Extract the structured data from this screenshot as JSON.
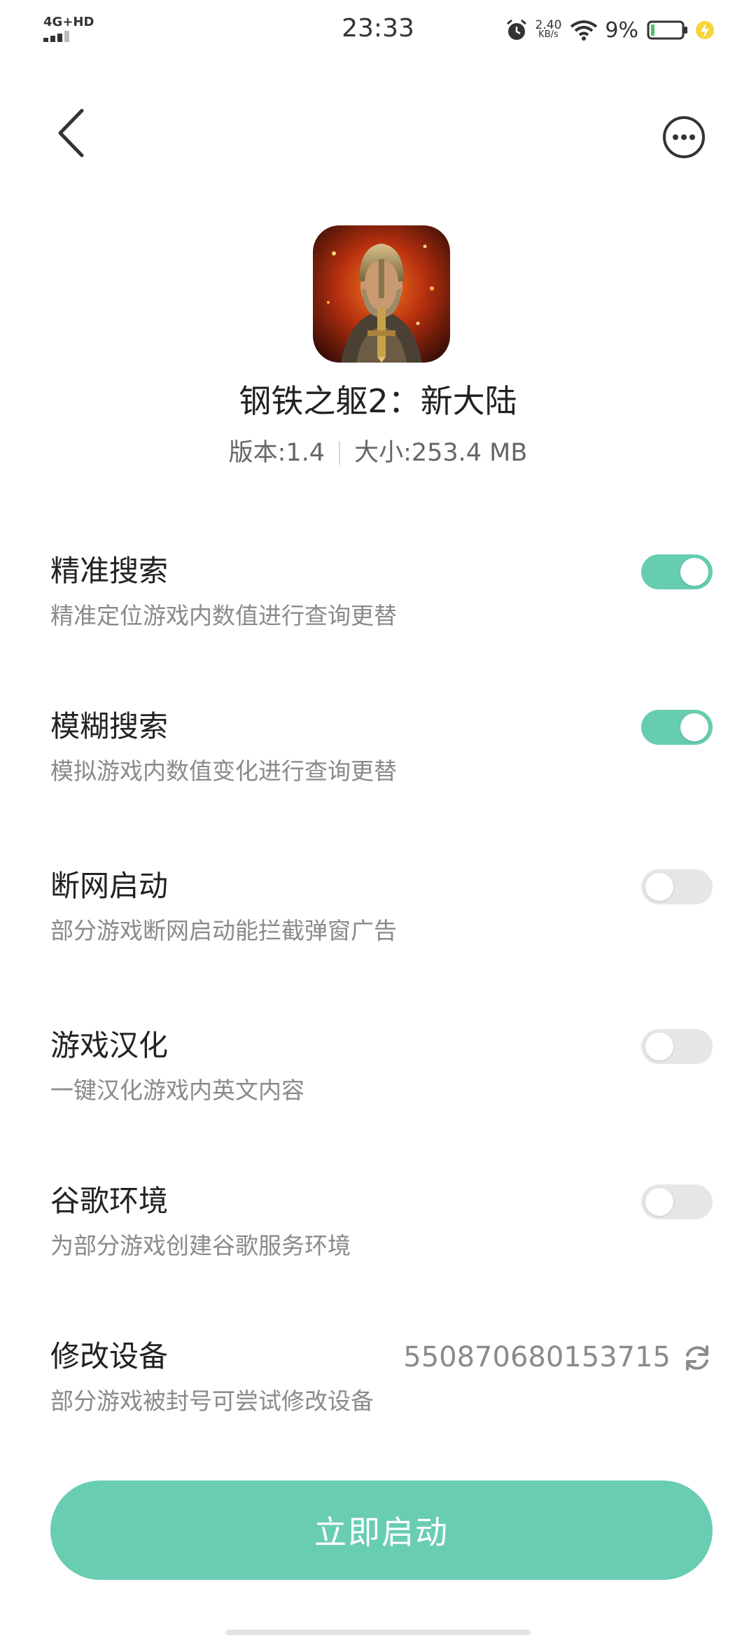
{
  "status_bar": {
    "network": "4G+HD",
    "time": "23:33",
    "net_speed_value": "2.40",
    "net_speed_unit": "KB/s",
    "battery_percent": "9%",
    "icons": [
      "signal-icon",
      "alarm-icon",
      "wifi-icon",
      "battery-icon",
      "charging-icon"
    ]
  },
  "nav": {
    "back_icon": "chevron-left-icon",
    "more_icon": "more-horizontal-icon"
  },
  "app": {
    "title": "钢铁之躯2：新大陆",
    "version": "版本:1.4",
    "size": "大小:253.4 MB",
    "icon": "game-app-icon"
  },
  "settings": [
    {
      "title": "精准搜索",
      "desc": "精准定位游戏内数值进行查询更替",
      "enabled": true
    },
    {
      "title": "模糊搜索",
      "desc": "模拟游戏内数值变化进行查询更替",
      "enabled": true
    },
    {
      "title": "断网启动",
      "desc": "部分游戏断网启动能拦截弹窗广告",
      "enabled": false
    },
    {
      "title": "游戏汉化",
      "desc": "一键汉化游戏内英文内容",
      "enabled": false
    },
    {
      "title": "谷歌环境",
      "desc": "为部分游戏创建谷歌服务环境",
      "enabled": false
    }
  ],
  "device": {
    "title": "修改设备",
    "desc": "部分游戏被封号可尝试修改设备",
    "value": "550870680153715",
    "refresh_icon": "refresh-icon"
  },
  "launch_button": {
    "label": "立即启动"
  },
  "colors": {
    "accent": "#66cdb1",
    "toggle_off": "#e6e6e6",
    "text_primary": "#222222",
    "text_secondary": "#8a8a8a"
  }
}
